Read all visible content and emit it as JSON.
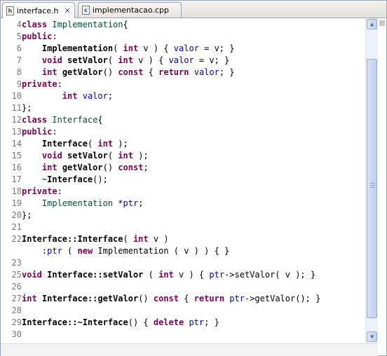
{
  "tabs": [
    {
      "label": "interface.h",
      "icon": "h-file-icon",
      "icon_letter": "h",
      "active": true,
      "close": "✕"
    },
    {
      "label": "implementacao.cpp",
      "icon": "cpp-file-icon",
      "icon_letter": "c",
      "active": false
    }
  ],
  "colors": {
    "keyword": "#7f0055",
    "type": "#005032",
    "field": "#0000c0",
    "line_number": "#787878",
    "tab_border": "#9aa6b6",
    "scrollbar": "#bfd1f1"
  },
  "lines": [
    {
      "n": "4",
      "tokens": [
        [
          "kw",
          "class"
        ],
        [
          "t",
          " "
        ],
        [
          "ty",
          "Implementation"
        ],
        [
          "t",
          "{"
        ]
      ]
    },
    {
      "n": "5",
      "tokens": [
        [
          "kw",
          "public"
        ],
        [
          "t",
          ":"
        ]
      ]
    },
    {
      "n": "6",
      "tokens": [
        [
          "t",
          "    "
        ],
        [
          "b",
          "Implementation"
        ],
        [
          "t",
          "( "
        ],
        [
          "kw",
          "int"
        ],
        [
          "t",
          " v ) { "
        ],
        [
          "fld",
          "valor"
        ],
        [
          "t",
          " = v; }"
        ]
      ]
    },
    {
      "n": "7",
      "tokens": [
        [
          "t",
          "    "
        ],
        [
          "kw",
          "void"
        ],
        [
          "t",
          " "
        ],
        [
          "b",
          "setValor"
        ],
        [
          "t",
          "( "
        ],
        [
          "kw",
          "int"
        ],
        [
          "t",
          " v ) { "
        ],
        [
          "fld",
          "valor"
        ],
        [
          "t",
          " = v; }"
        ]
      ]
    },
    {
      "n": "8",
      "tokens": [
        [
          "t",
          "    "
        ],
        [
          "kw",
          "int"
        ],
        [
          "t",
          " "
        ],
        [
          "b",
          "getValor"
        ],
        [
          "t",
          "() "
        ],
        [
          "kw",
          "const"
        ],
        [
          "t",
          " { "
        ],
        [
          "kw",
          "return"
        ],
        [
          "t",
          " "
        ],
        [
          "fld",
          "valor"
        ],
        [
          "t",
          "; }"
        ]
      ]
    },
    {
      "n": "9",
      "tokens": [
        [
          "kw",
          "private"
        ],
        [
          "t",
          ":"
        ]
      ]
    },
    {
      "n": "10",
      "tokens": [
        [
          "t",
          "        "
        ],
        [
          "kw",
          "int"
        ],
        [
          "t",
          " "
        ],
        [
          "fld",
          "valor"
        ],
        [
          "t",
          ";"
        ]
      ]
    },
    {
      "n": "11",
      "tokens": [
        [
          "t",
          "};"
        ]
      ]
    },
    {
      "n": "12",
      "tokens": [
        [
          "kw",
          "class"
        ],
        [
          "t",
          " "
        ],
        [
          "ty",
          "Interface"
        ],
        [
          "t",
          "{"
        ]
      ]
    },
    {
      "n": "13",
      "tokens": [
        [
          "kw",
          "public"
        ],
        [
          "t",
          ":"
        ]
      ]
    },
    {
      "n": "14",
      "tokens": [
        [
          "t",
          "    "
        ],
        [
          "b",
          "Interface"
        ],
        [
          "t",
          "( "
        ],
        [
          "kw",
          "int"
        ],
        [
          "t",
          " );"
        ]
      ]
    },
    {
      "n": "15",
      "tokens": [
        [
          "t",
          "    "
        ],
        [
          "kw",
          "void"
        ],
        [
          "t",
          " "
        ],
        [
          "b",
          "setValor"
        ],
        [
          "t",
          "( "
        ],
        [
          "kw",
          "int"
        ],
        [
          "t",
          " );"
        ]
      ]
    },
    {
      "n": "16",
      "tokens": [
        [
          "t",
          "    "
        ],
        [
          "kw",
          "int"
        ],
        [
          "t",
          " "
        ],
        [
          "b",
          "getValor"
        ],
        [
          "t",
          "() "
        ],
        [
          "kw",
          "const"
        ],
        [
          "t",
          ";"
        ]
      ]
    },
    {
      "n": "17",
      "tokens": [
        [
          "t",
          "    ~"
        ],
        [
          "b",
          "Interface"
        ],
        [
          "t",
          "();"
        ]
      ]
    },
    {
      "n": "18",
      "tokens": [
        [
          "kw",
          "private"
        ],
        [
          "t",
          ":"
        ]
      ]
    },
    {
      "n": "19",
      "tokens": [
        [
          "t",
          "    "
        ],
        [
          "ty",
          "Implementation"
        ],
        [
          "t",
          " *"
        ],
        [
          "fld",
          "ptr"
        ],
        [
          "t",
          ";"
        ]
      ]
    },
    {
      "n": "20",
      "tokens": [
        [
          "t",
          "};"
        ]
      ]
    },
    {
      "n": "21",
      "tokens": []
    },
    {
      "n": "22",
      "tokens": [
        [
          "b",
          "Interface::Interface"
        ],
        [
          "t",
          "( "
        ],
        [
          "kw",
          "int"
        ],
        [
          "t",
          " v )"
        ]
      ]
    },
    {
      "n": "",
      "tokens": [
        [
          "t",
          "    :"
        ],
        [
          "fld",
          "ptr"
        ],
        [
          "t",
          " ( "
        ],
        [
          "kw",
          "new"
        ],
        [
          "t",
          " Implementation ( v ) ) { }"
        ]
      ]
    },
    {
      "n": "23",
      "tokens": []
    },
    {
      "n": "25",
      "tokens": [
        [
          "kw",
          "void"
        ],
        [
          "t",
          " "
        ],
        [
          "b",
          "Interface::setValor"
        ],
        [
          "t",
          " ( "
        ],
        [
          "kw",
          "int"
        ],
        [
          "t",
          " v ) { "
        ],
        [
          "fld",
          "ptr"
        ],
        [
          "t",
          "->setValor( v ); }"
        ]
      ]
    },
    {
      "n": "26",
      "tokens": []
    },
    {
      "n": "27",
      "tokens": [
        [
          "kw",
          "int"
        ],
        [
          "t",
          " "
        ],
        [
          "b",
          "Interface::getValor"
        ],
        [
          "t",
          "() "
        ],
        [
          "kw",
          "const"
        ],
        [
          "t",
          " { "
        ],
        [
          "kw",
          "return"
        ],
        [
          "t",
          " "
        ],
        [
          "fld",
          "ptr"
        ],
        [
          "t",
          "->getValor(); }"
        ]
      ]
    },
    {
      "n": "28",
      "tokens": []
    },
    {
      "n": "29",
      "tokens": [
        [
          "b",
          "Interface::~Interface"
        ],
        [
          "t",
          "() { "
        ],
        [
          "kw",
          "delete"
        ],
        [
          "t",
          " "
        ],
        [
          "fld",
          "ptr"
        ],
        [
          "t",
          "; }"
        ]
      ]
    },
    {
      "n": "30",
      "tokens": []
    }
  ],
  "scrollbar": {
    "up": "▲",
    "down": "▼"
  }
}
